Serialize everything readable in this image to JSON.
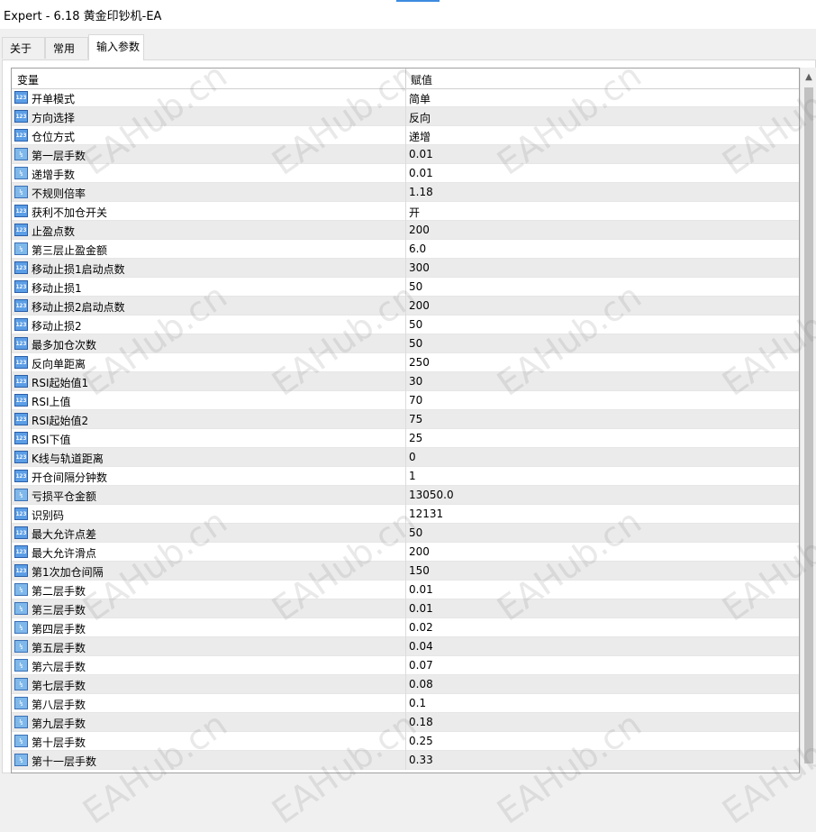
{
  "window": {
    "title": "Expert - 6.18 黄金印钞机-EA"
  },
  "tabs": [
    {
      "label": "关于"
    },
    {
      "label": "常用"
    },
    {
      "label": "输入参数"
    }
  ],
  "table": {
    "col_variable": "变量",
    "col_value": "赋值",
    "rows": [
      {
        "icon": "int",
        "name": "开单模式",
        "value": "简单"
      },
      {
        "icon": "int",
        "name": "方向选择",
        "value": "反向"
      },
      {
        "icon": "int",
        "name": "仓位方式",
        "value": "递增"
      },
      {
        "icon": "double",
        "name": "第一层手数",
        "value": "0.01"
      },
      {
        "icon": "double",
        "name": "递增手数",
        "value": "0.01"
      },
      {
        "icon": "double",
        "name": "不规则倍率",
        "value": "1.18"
      },
      {
        "icon": "int",
        "name": "获利不加仓开关",
        "value": "开"
      },
      {
        "icon": "int",
        "name": "止盈点数",
        "value": "200"
      },
      {
        "icon": "double",
        "name": "第三层止盈金额",
        "value": "6.0"
      },
      {
        "icon": "int",
        "name": "移动止损1启动点数",
        "value": "300"
      },
      {
        "icon": "int",
        "name": "移动止损1",
        "value": "50"
      },
      {
        "icon": "int",
        "name": "移动止损2启动点数",
        "value": "200"
      },
      {
        "icon": "int",
        "name": "移动止损2",
        "value": "50"
      },
      {
        "icon": "int",
        "name": "最多加仓次数",
        "value": "50"
      },
      {
        "icon": "int",
        "name": "反向单距离",
        "value": "250"
      },
      {
        "icon": "int",
        "name": "RSI起始值1",
        "value": "30"
      },
      {
        "icon": "int",
        "name": "RSI上值",
        "value": "70"
      },
      {
        "icon": "int",
        "name": "RSI起始值2",
        "value": "75"
      },
      {
        "icon": "int",
        "name": "RSI下值",
        "value": "25"
      },
      {
        "icon": "int",
        "name": "K线与轨道距离",
        "value": "0"
      },
      {
        "icon": "int",
        "name": "开仓间隔分钟数",
        "value": "1"
      },
      {
        "icon": "double",
        "name": "亏损平仓金额",
        "value": "13050.0"
      },
      {
        "icon": "int",
        "name": "识别码",
        "value": "12131"
      },
      {
        "icon": "int",
        "name": "最大允许点差",
        "value": "50"
      },
      {
        "icon": "int",
        "name": "最大允许滑点",
        "value": "200"
      },
      {
        "icon": "int",
        "name": "第1次加仓间隔",
        "value": "150"
      },
      {
        "icon": "double",
        "name": "第二层手数",
        "value": "0.01"
      },
      {
        "icon": "double",
        "name": "第三层手数",
        "value": "0.01"
      },
      {
        "icon": "double",
        "name": "第四层手数",
        "value": "0.02"
      },
      {
        "icon": "double",
        "name": "第五层手数",
        "value": "0.04"
      },
      {
        "icon": "double",
        "name": "第六层手数",
        "value": "0.07"
      },
      {
        "icon": "double",
        "name": "第七层手数",
        "value": "0.08"
      },
      {
        "icon": "double",
        "name": "第八层手数",
        "value": "0.1"
      },
      {
        "icon": "double",
        "name": "第九层手数",
        "value": "0.18"
      },
      {
        "icon": "double",
        "name": "第十层手数",
        "value": "0.25"
      },
      {
        "icon": "double",
        "name": "第十一层手数",
        "value": "0.33"
      }
    ]
  },
  "icons": {
    "int": "123",
    "double": "½"
  },
  "watermark": "EAHub.cn",
  "colors": {
    "row_alt": "#ebebeb",
    "icon_blue": "#5b9ee6"
  }
}
